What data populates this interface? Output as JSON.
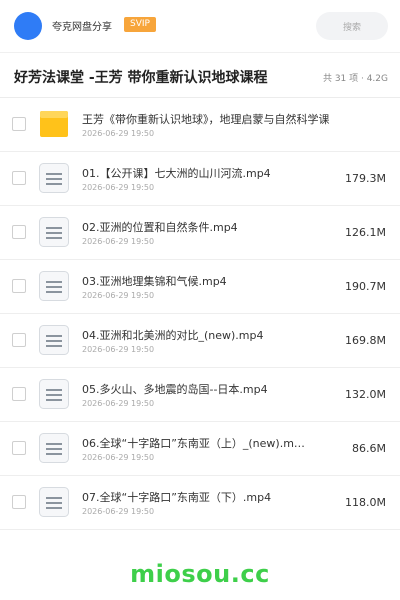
{
  "header": {
    "user_name": "夸克网盘分享",
    "badge": "SVIP",
    "search_placeholder": "搜索"
  },
  "folder": {
    "title": "好芳法课堂 -王芳 带你重新认识地球课程",
    "summary": "共 31 项 · 4.2G"
  },
  "files": [
    {
      "name": "王芳《带你重新认识地球》，地理启蒙与自然科学课",
      "date": "2026-06-29 19:50",
      "size": "",
      "icon": "folder-icon"
    },
    {
      "name": "01.【公开课】七大洲的山川河流.mp4",
      "date": "2026-06-29 19:50",
      "size": "179.3M",
      "icon": "file-icon"
    },
    {
      "name": "02.亚洲的位置和自然条件.mp4",
      "date": "2026-06-29 19:50",
      "size": "126.1M",
      "icon": "file-icon"
    },
    {
      "name": "03.亚洲地理集锦和气候.mp4",
      "date": "2026-06-29 19:50",
      "size": "190.7M",
      "icon": "file-icon"
    },
    {
      "name": "04.亚洲和北美洲的对比_(new).mp4",
      "date": "2026-06-29 19:50",
      "size": "169.8M",
      "icon": "file-icon"
    },
    {
      "name": "05.多火山、多地震的岛国--日本.mp4",
      "date": "2026-06-29 19:50",
      "size": "132.0M",
      "icon": "file-icon"
    },
    {
      "name": "06.全球“十字路口”东南亚（上）_(new).m…",
      "date": "2026-06-29 19:50",
      "size": "86.6M",
      "icon": "file-icon"
    },
    {
      "name": "07.全球“十字路口”东南亚（下）.mp4",
      "date": "2026-06-29 19:50",
      "size": "118.0M",
      "icon": "file-icon"
    }
  ],
  "footer": {
    "watermark": "miosou.cc"
  }
}
